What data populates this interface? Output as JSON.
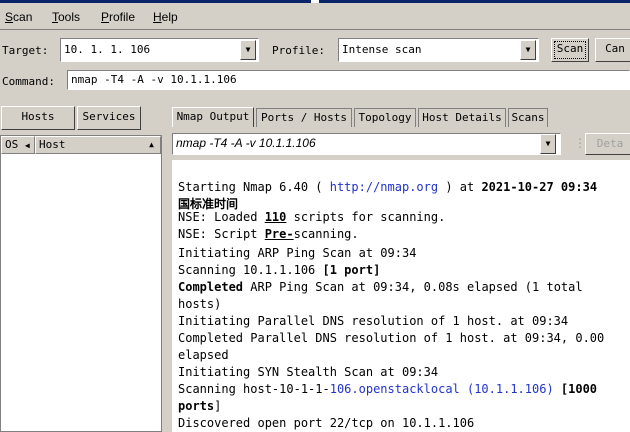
{
  "menu": {
    "scan": "Scan",
    "tools": "Tools",
    "profile": "Profile",
    "help": "Help"
  },
  "target": {
    "label": "Target:",
    "value": "10. 1. 1. 106"
  },
  "profile": {
    "label": "Profile:",
    "value": "Intense scan"
  },
  "buttons": {
    "scan": "Scan",
    "cancel": "Can"
  },
  "command": {
    "label": "Command:",
    "value": "nmap -T4 -A -v 10.1.1.106"
  },
  "left_tabs": {
    "hosts": "Hosts",
    "services": "Services"
  },
  "host_list": {
    "col_os": "OS",
    "col_host": "Host"
  },
  "right_tabs": [
    "Nmap Output",
    "Ports / Hosts",
    "Topology",
    "Host Details",
    "Scans"
  ],
  "output_select": {
    "value": "nmap -T4 -A -v 10.1.1.106"
  },
  "details_button": "Deta",
  "output": {
    "l1a": "Starting Nmap 6.40 ( ",
    "l1url": "http://nmap.org",
    "l1b": " ) at ",
    "l1date": "2021-10-27 09:34",
    "l2": "国标准时间",
    "l3a": "NSE: Loaded ",
    "l3n": "110",
    "l3b": " scripts for scanning.",
    "l4a": "NSE: Script ",
    "l4pre": "Pre-",
    "l4b": "scanning.",
    "l5": "Initiating ARP Ping Scan at 09:34",
    "l6a": "Scanning 10.1.1.106 ",
    "l6b": "[1 port]",
    "l7a": "Completed",
    "l7b": " ARP Ping Scan at 09:34, 0.08s elapsed (1 total",
    "l8": "hosts)",
    "l9": "Initiating Parallel DNS resolution of 1 host. at 09:34",
    "l10": "Completed Parallel DNS resolution of 1 host. at 09:34, 0.00",
    "l11": "elapsed",
    "l12": "Initiating SYN Stealth Scan at 09:34",
    "l13a": "Scanning host-10-1-1-",
    "l13b": "106.openstacklocal (10.1.1.106)",
    "l13c": " [1000",
    "l14a": "ports",
    "l14b": "]",
    "l15": "Discovered open port 22/tcp on 10.1.1.106"
  }
}
